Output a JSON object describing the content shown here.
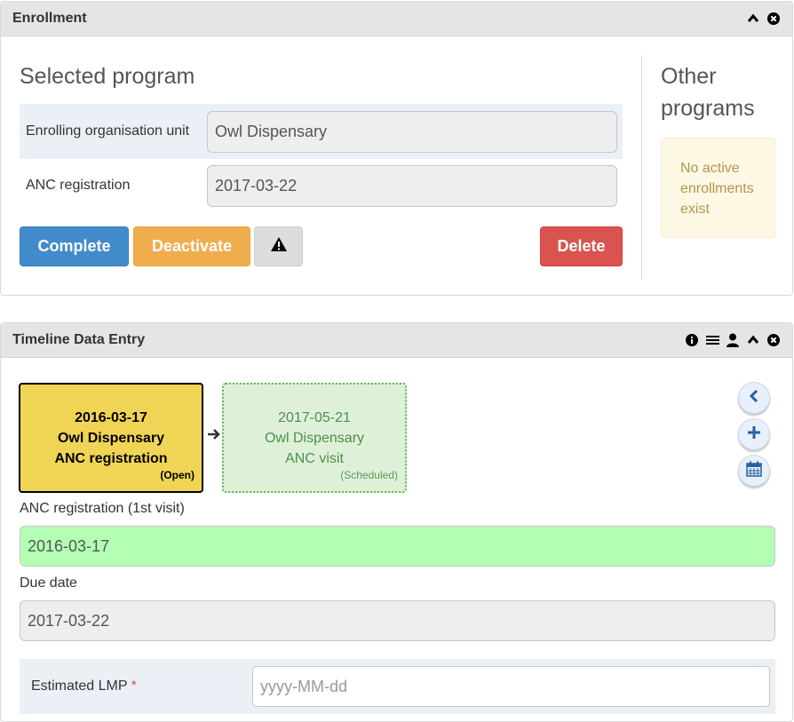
{
  "enrollment": {
    "title": "Enrollment",
    "selected_title": "Selected program",
    "rows": [
      {
        "label": "Enrolling organisation unit",
        "value": "Owl Dispensary"
      },
      {
        "label": "ANC registration",
        "value": "2017-03-22"
      }
    ],
    "buttons": {
      "complete": "Complete",
      "deactivate": "Deactivate",
      "delete": "Delete"
    },
    "other_title": "Other programs",
    "other_message": "No active enrollments exist",
    "icons": [
      "chevron-up-icon",
      "close-circle-icon",
      "warning-icon"
    ]
  },
  "timeline": {
    "title": "Timeline Data Entry",
    "icons": [
      "info-icon",
      "list-icon",
      "user-icon",
      "chevron-up-icon",
      "close-circle-icon",
      "arrow-right-icon",
      "chevron-left-icon",
      "plus-icon",
      "calendar-icon"
    ],
    "events": [
      {
        "date": "2016-03-17",
        "org": "Owl Dispensary",
        "stage": "ANC registration",
        "status": "(Open)"
      },
      {
        "date": "2017-05-21",
        "org": "Owl Dispensary",
        "stage": "ANC visit",
        "status": "(Scheduled)"
      }
    ],
    "fields": {
      "registration_label": "ANC registration (1st visit)",
      "registration_value": "2016-03-17",
      "due_label": "Due date",
      "due_value": "2017-03-22",
      "lmp_label": "Estimated LMP",
      "lmp_required": "*",
      "lmp_placeholder": "yyyy-MM-dd"
    }
  },
  "colors": {
    "primary": "#428bca",
    "warning": "#f0ad4e",
    "danger": "#d9534f",
    "open_event": "#f0d456",
    "scheduled_event": "#dff0d8",
    "valid_field": "#b3ffb4"
  }
}
